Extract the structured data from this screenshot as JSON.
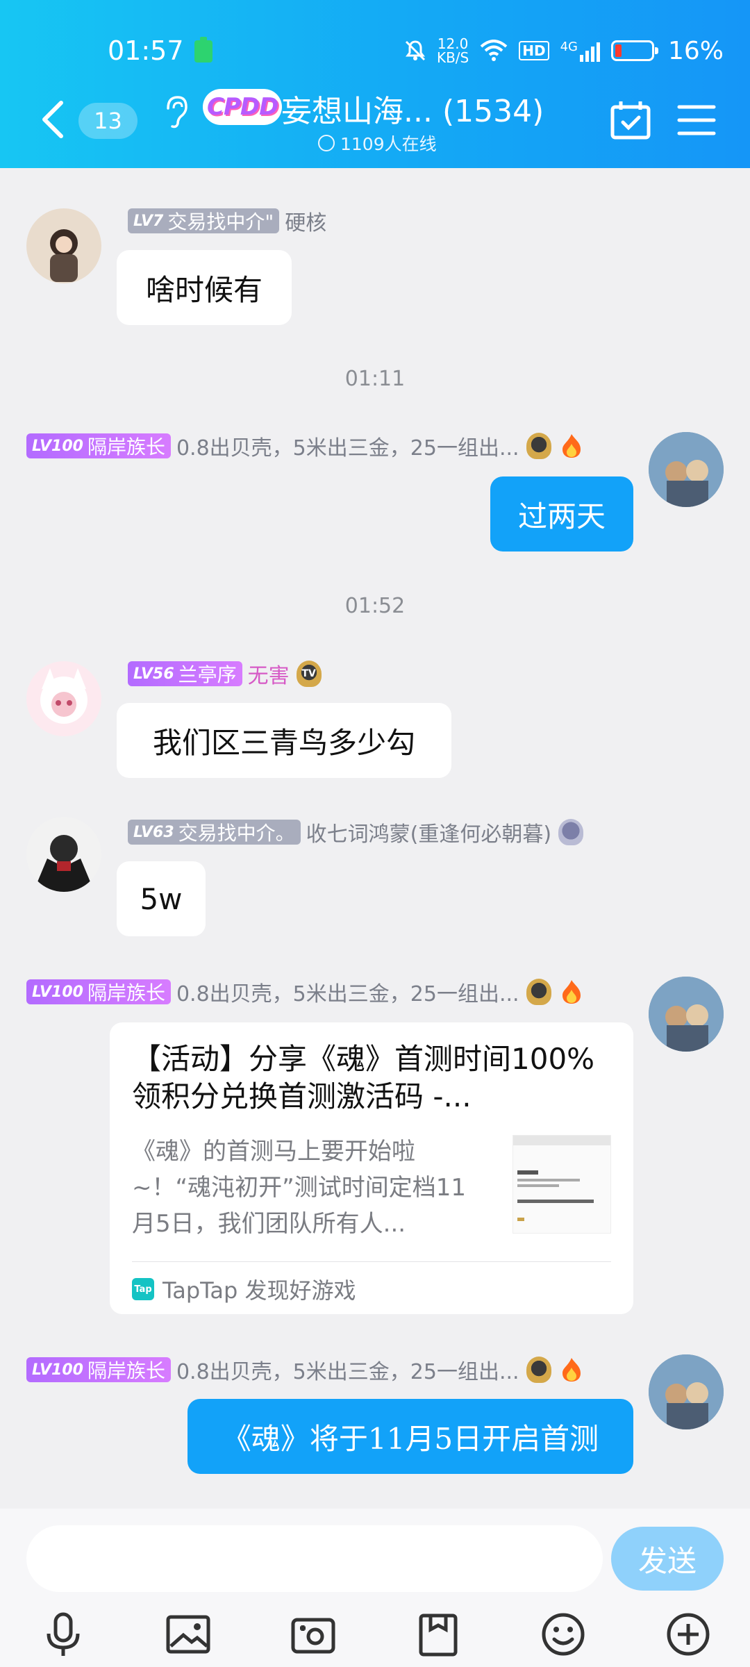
{
  "status_bar": {
    "time": "01:57",
    "net_speed_value": "12.0",
    "net_speed_unit": "KB/S",
    "hd": "HD",
    "network": "4G",
    "battery": "16%"
  },
  "header": {
    "unread_count": "13",
    "badge": "CPDD",
    "title": "妄想山海... (1534)",
    "online": "1109人在线"
  },
  "messages": [
    {
      "level": "LV7",
      "title": "交易找中介\"",
      "nickname": "硬核",
      "text": "啥时候有"
    },
    {
      "time": "01:11"
    },
    {
      "level": "LV100",
      "title": "隔岸族长",
      "nickname": "0.8出贝壳，5米出三金，25一组出...",
      "text": "过两天"
    },
    {
      "time": "01:52"
    },
    {
      "level": "LV56",
      "title": "兰亭序",
      "nickname": "无害",
      "badge": "TV",
      "text": "我们区三青鸟多少勾"
    },
    {
      "level": "LV63",
      "title": "交易找中介。",
      "nickname": "收七词鸿蒙(重逢何必朝暮)",
      "text": "5w"
    },
    {
      "level": "LV100",
      "title": "隔岸族长",
      "nickname": "0.8出贝壳，5米出三金，25一组出..."
    },
    {
      "level": "LV100",
      "title": "隔岸族长",
      "nickname": "0.8出贝壳，5米出三金，25一组出...",
      "text": "《魂》将于11月5日开启首测"
    }
  ],
  "share_card": {
    "title": "【活动】分享《魂》首测时间100%领积分兑换首测激活码 -...",
    "description": "《魂》的首测马上要开始啦~！“魂沌初开”测试时间定档11月5日，我们团队所有人...",
    "source_logo": "Tap",
    "source": "TapTap 发现好游戏"
  },
  "input": {
    "placeholder": "",
    "send_label": "发送"
  },
  "toolbar": [
    "mic-icon",
    "image-icon",
    "camera-icon",
    "file-icon",
    "emoji-icon",
    "plus-icon"
  ]
}
